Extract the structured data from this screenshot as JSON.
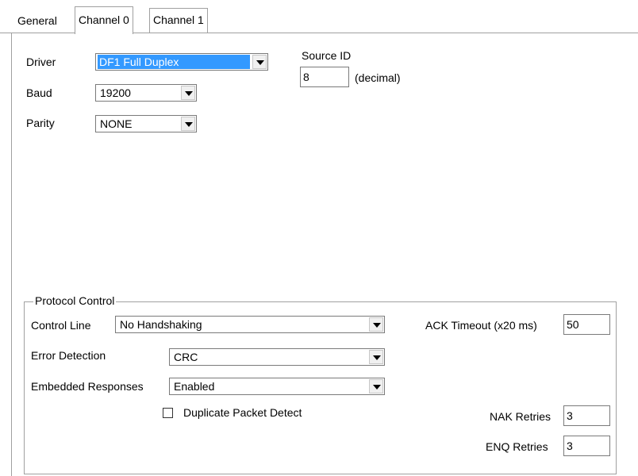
{
  "tabs": [
    "General",
    "Channel 0",
    "Channel 1"
  ],
  "selected_tab": "Channel 0",
  "channel": {
    "driver_label": "Driver",
    "driver_value": "DF1 Full Duplex",
    "baud_label": "Baud",
    "baud_value": "19200",
    "parity_label": "Parity",
    "parity_value": "NONE",
    "source_id_label": "Source ID",
    "source_id_value": "8",
    "source_id_unit": "(decimal)"
  },
  "protocol": {
    "title": "Protocol Control",
    "control_line_label": "Control Line",
    "control_line_value": "No Handshaking",
    "error_detection_label": "Error Detection",
    "error_detection_value": "CRC",
    "embedded_responses_label": "Embedded Responses",
    "embedded_responses_value": "Enabled",
    "duplicate_packet_label": "Duplicate Packet Detect",
    "duplicate_packet_checked": false,
    "ack_timeout_label": "ACK Timeout (x20 ms)",
    "ack_timeout_value": "50",
    "nak_retries_label": "NAK Retries",
    "nak_retries_value": "3",
    "enq_retries_label": "ENQ Retries",
    "enq_retries_value": "3"
  },
  "colors": {
    "selection": "#3399ff",
    "border": "#7a7a7a",
    "tab_border": "#a0a0a0"
  }
}
